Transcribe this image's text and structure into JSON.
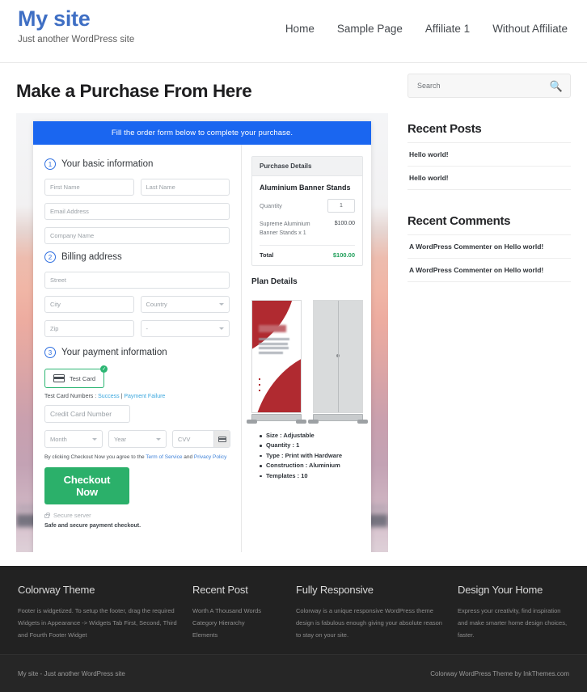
{
  "header": {
    "site_title": "My site",
    "tagline": "Just another WordPress site",
    "nav": [
      {
        "label": "Home"
      },
      {
        "label": "Sample Page"
      },
      {
        "label": "Affiliate 1"
      },
      {
        "label": "Without Affiliate"
      }
    ]
  },
  "main": {
    "page_title": "Make a Purchase From Here",
    "checkout": {
      "banner": "Fill the order form below to complete your purchase.",
      "steps": [
        {
          "num": "1",
          "label": "Your basic information"
        },
        {
          "num": "2",
          "label": "Billing address"
        },
        {
          "num": "3",
          "label": "Your payment information"
        }
      ],
      "fields": {
        "first_name": "First Name",
        "last_name": "Last Name",
        "email": "Email Address",
        "company": "Company Name",
        "street": "Street",
        "city": "City",
        "country": "Country",
        "zip": "Zip",
        "state": "-",
        "credit_card": "Credit Card Number",
        "month": "Month",
        "year": "Year",
        "cvv": "CVV"
      },
      "payment": {
        "test_card_label": "Test Card",
        "test_numbers_prefix": "Test Card Numbers :",
        "test_success": "Success",
        "test_separator": "|",
        "test_failure": "Payment Failure",
        "terms_prefix": "By clicking Checkout Now you agree to the",
        "terms_link1": "Term of Service",
        "terms_and": "and",
        "terms_link2": "Privacy Policy",
        "checkout_button": "Checkout Now",
        "secure_server": "Secure server",
        "safe_note": "Safe and secure payment checkout."
      },
      "purchase_details": {
        "heading": "Purchase Details",
        "product": "Aluminium Banner Stands",
        "quantity_label": "Quantity",
        "quantity_value": "1",
        "line_item": "Supreme Aluminium Banner Stands x 1",
        "line_amount": "$100.00",
        "total_label": "Total",
        "total_amount": "$100.00"
      },
      "plan_details": {
        "heading": "Plan Details",
        "items": [
          "Size : Adjustable",
          "Quantity : 1",
          "Type : Print with Hardware",
          "Construction : Aluminium",
          "Templates : 10"
        ]
      }
    }
  },
  "sidebar": {
    "search": {
      "placeholder": "Search",
      "icon": "search-icon"
    },
    "recent_posts": {
      "title": "Recent Posts",
      "items": [
        {
          "label": "Hello world!"
        },
        {
          "label": "Hello world!"
        }
      ]
    },
    "recent_comments": {
      "title": "Recent Comments",
      "items": [
        {
          "label": "A WordPress Commenter on Hello world!"
        },
        {
          "label": "A WordPress Commenter on Hello world!"
        }
      ]
    }
  },
  "footer": {
    "columns": [
      {
        "title": "Colorway Theme",
        "text": "Footer is widgetized. To setup the footer, drag the required Widgets in Appearance -> Widgets Tab First, Second, Third and Fourth Footer Widget"
      },
      {
        "title": "Recent Post",
        "links": [
          {
            "label": "Worth A Thousand Words"
          },
          {
            "label": "Category Hierarchy"
          },
          {
            "label": "Elements"
          }
        ]
      },
      {
        "title": "Fully Responsive",
        "text": "Colorway is a unique responsive WordPress theme design is fabulous enough giving your absolute reason to stay on your site."
      },
      {
        "title": "Design Your Home",
        "text": "Express your creativity, find inspiration and make smarter home design choices, faster."
      }
    ],
    "bottom_left": "My site - Just another WordPress site",
    "bottom_right": "Colorway WordPress Theme by InkThemes.com"
  },
  "colors": {
    "brand_blue": "#3f6fc4",
    "banner_blue": "#1a66f0",
    "checkout_green": "#2bb06a",
    "total_green": "#22a05c",
    "footer_dark": "#222222"
  }
}
